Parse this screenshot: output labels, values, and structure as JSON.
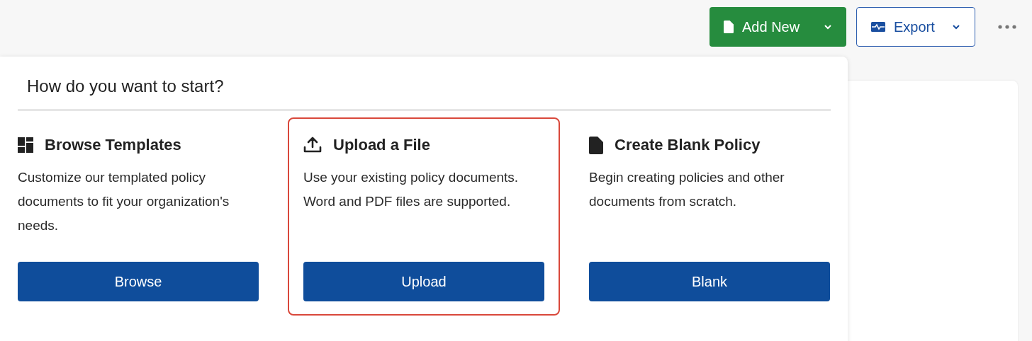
{
  "toolbar": {
    "add_new": "Add New",
    "export": "Export"
  },
  "menu": {
    "title": "How do you want to start?",
    "options": [
      {
        "kind": "templates",
        "title": "Browse Templates",
        "description": "Customize our templated policy documents to fit your organization's needs.",
        "button": "Browse",
        "selected": false
      },
      {
        "kind": "upload",
        "title": "Upload a File",
        "description": "Use your existing policy documents. Word and PDF files are supported.",
        "button": "Upload",
        "selected": true
      },
      {
        "kind": "blank",
        "title": "Create Blank Policy",
        "description": "Begin creating policies and other documents from scratch.",
        "button": "Blank",
        "selected": false
      }
    ]
  }
}
